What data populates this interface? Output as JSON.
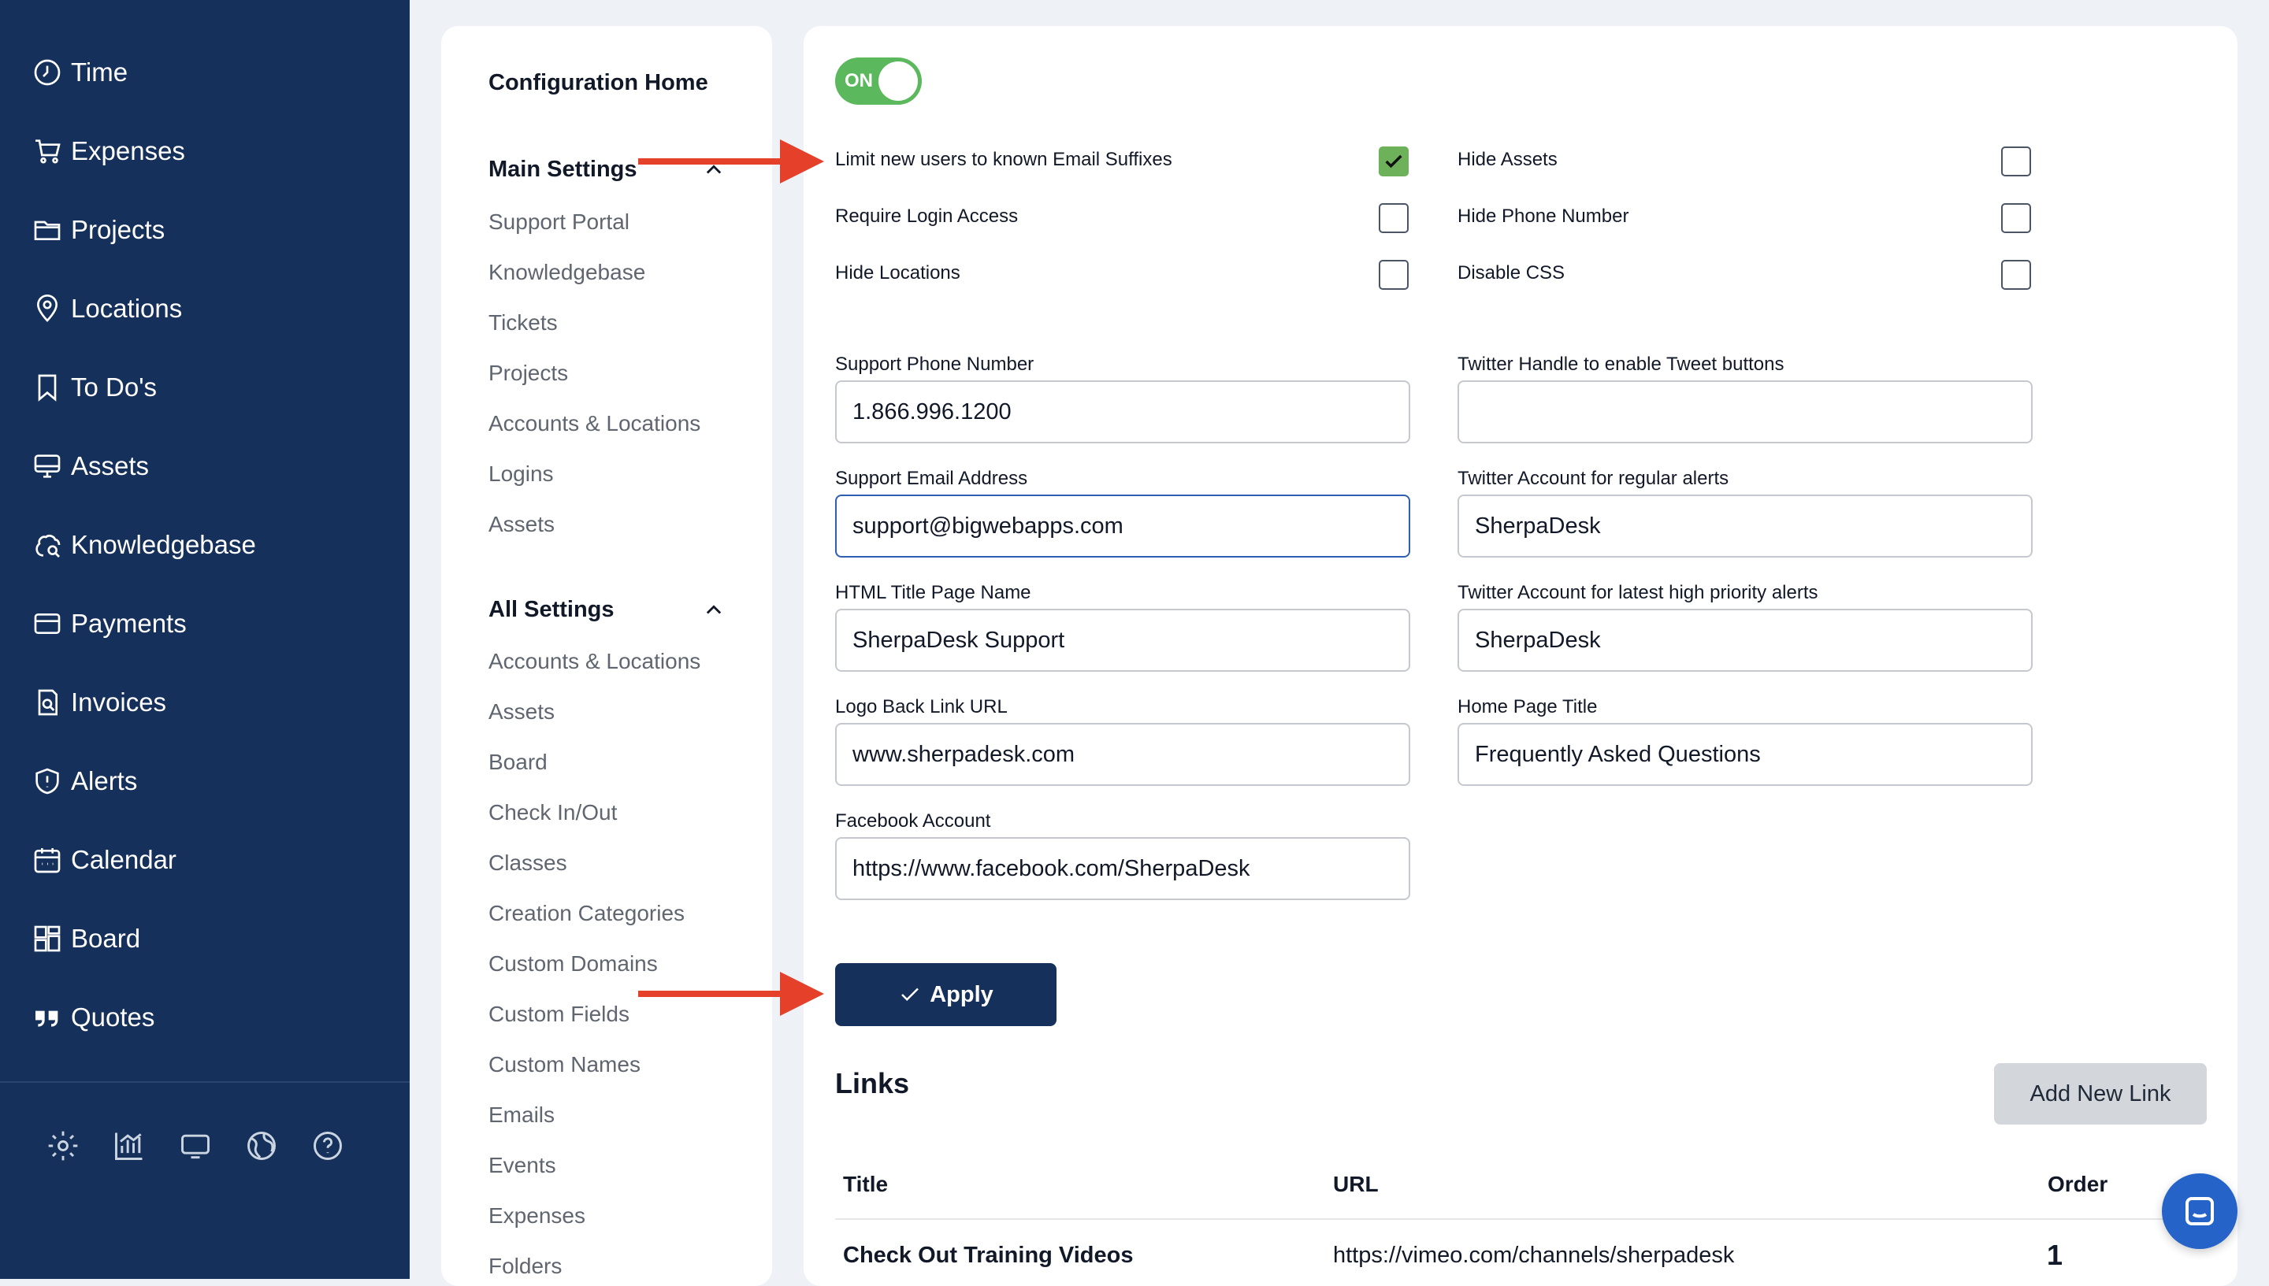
{
  "sidebar": {
    "items": [
      {
        "label": "Time",
        "icon": "clock-icon"
      },
      {
        "label": "Expenses",
        "icon": "cart-icon"
      },
      {
        "label": "Projects",
        "icon": "folder-icon"
      },
      {
        "label": "Locations",
        "icon": "map-pin-icon"
      },
      {
        "label": "To Do's",
        "icon": "bookmark-icon"
      },
      {
        "label": "Assets",
        "icon": "monitor-icon"
      },
      {
        "label": "Knowledgebase",
        "icon": "knowledge-icon"
      },
      {
        "label": "Payments",
        "icon": "credit-card-icon"
      },
      {
        "label": "Invoices",
        "icon": "invoice-icon"
      },
      {
        "label": "Alerts",
        "icon": "shield-alert-icon"
      },
      {
        "label": "Calendar",
        "icon": "calendar-icon"
      },
      {
        "label": "Board",
        "icon": "board-icon"
      },
      {
        "label": "Quotes",
        "icon": "quote-icon"
      }
    ],
    "bottom_icons": [
      "gear-icon",
      "chart-icon",
      "display-icon",
      "globe-icon",
      "help-icon"
    ]
  },
  "config_nav": {
    "home": "Configuration Home",
    "main_settings": {
      "title": "Main Settings",
      "items": [
        "Support Portal",
        "Knowledgebase",
        "Tickets",
        "Projects",
        "Accounts & Locations",
        "Logins",
        "Assets"
      ]
    },
    "all_settings": {
      "title": "All Settings",
      "items": [
        "Accounts & Locations",
        "Assets",
        "Board",
        "Check In/Out",
        "Classes",
        "Creation Categories",
        "Custom Domains",
        "Custom Fields",
        "Custom Names",
        "Emails",
        "Events",
        "Expenses",
        "Folders"
      ]
    }
  },
  "portal": {
    "toggle_label": "ON",
    "checkboxes_left": [
      {
        "label": "Limit new users to known Email Suffixes",
        "checked": true
      },
      {
        "label": "Require Login Access",
        "checked": false
      },
      {
        "label": "Hide Locations",
        "checked": false
      }
    ],
    "checkboxes_right": [
      {
        "label": "Hide Assets",
        "checked": false
      },
      {
        "label": "Hide Phone Number",
        "checked": false
      },
      {
        "label": "Disable CSS",
        "checked": false
      }
    ],
    "fields_left": [
      {
        "label": "Support Phone Number",
        "value": "1.866.996.1200"
      },
      {
        "label": "Support Email Address",
        "value": "support@bigwebapps.com"
      },
      {
        "label": "HTML Title Page Name",
        "value": "SherpaDesk Support"
      },
      {
        "label": "Logo Back Link URL",
        "value": "www.sherpadesk.com"
      },
      {
        "label": "Facebook Account",
        "value": "https://www.facebook.com/SherpaDesk"
      }
    ],
    "fields_right": [
      {
        "label": "Twitter Handle to enable Tweet buttons",
        "value": ""
      },
      {
        "label": "Twitter Account for regular alerts",
        "value": "SherpaDesk"
      },
      {
        "label": "Twitter Account for latest high priority alerts",
        "value": "SherpaDesk"
      },
      {
        "label": "Home Page Title",
        "value": "Frequently Asked Questions"
      }
    ],
    "apply_label": "Apply"
  },
  "links": {
    "title": "Links",
    "add_label": "Add New Link",
    "columns": [
      "Title",
      "URL",
      "Order"
    ],
    "rows": [
      {
        "title": "Check Out Training Videos",
        "url": "https://vimeo.com/channels/sherpadesk",
        "order": "1"
      }
    ]
  },
  "colors": {
    "sidebar_bg": "#15305a",
    "accent_green": "#5cb85c",
    "annotation_arrow": "#e5402a",
    "chat_blue": "#2563c9"
  }
}
